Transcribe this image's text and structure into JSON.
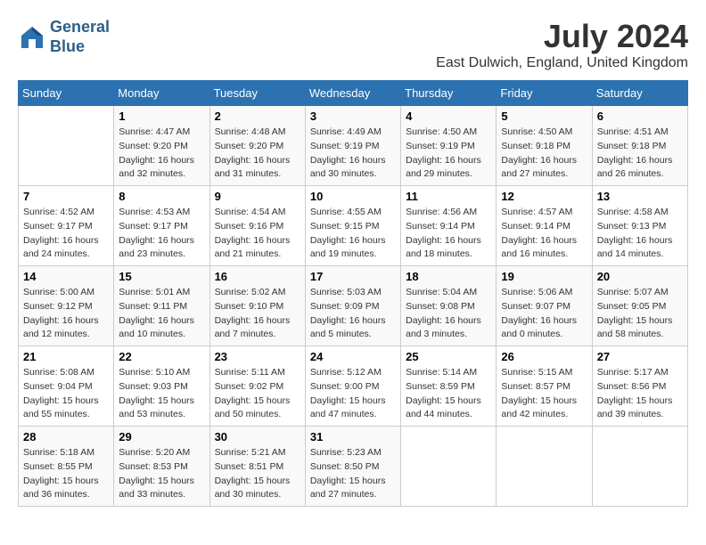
{
  "logo": {
    "line1": "General",
    "line2": "Blue"
  },
  "title": "July 2024",
  "location": "East Dulwich, England, United Kingdom",
  "days_of_week": [
    "Sunday",
    "Monday",
    "Tuesday",
    "Wednesday",
    "Thursday",
    "Friday",
    "Saturday"
  ],
  "weeks": [
    [
      {
        "day": "",
        "info": ""
      },
      {
        "day": "1",
        "info": "Sunrise: 4:47 AM\nSunset: 9:20 PM\nDaylight: 16 hours\nand 32 minutes."
      },
      {
        "day": "2",
        "info": "Sunrise: 4:48 AM\nSunset: 9:20 PM\nDaylight: 16 hours\nand 31 minutes."
      },
      {
        "day": "3",
        "info": "Sunrise: 4:49 AM\nSunset: 9:19 PM\nDaylight: 16 hours\nand 30 minutes."
      },
      {
        "day": "4",
        "info": "Sunrise: 4:50 AM\nSunset: 9:19 PM\nDaylight: 16 hours\nand 29 minutes."
      },
      {
        "day": "5",
        "info": "Sunrise: 4:50 AM\nSunset: 9:18 PM\nDaylight: 16 hours\nand 27 minutes."
      },
      {
        "day": "6",
        "info": "Sunrise: 4:51 AM\nSunset: 9:18 PM\nDaylight: 16 hours\nand 26 minutes."
      }
    ],
    [
      {
        "day": "7",
        "info": "Sunrise: 4:52 AM\nSunset: 9:17 PM\nDaylight: 16 hours\nand 24 minutes."
      },
      {
        "day": "8",
        "info": "Sunrise: 4:53 AM\nSunset: 9:17 PM\nDaylight: 16 hours\nand 23 minutes."
      },
      {
        "day": "9",
        "info": "Sunrise: 4:54 AM\nSunset: 9:16 PM\nDaylight: 16 hours\nand 21 minutes."
      },
      {
        "day": "10",
        "info": "Sunrise: 4:55 AM\nSunset: 9:15 PM\nDaylight: 16 hours\nand 19 minutes."
      },
      {
        "day": "11",
        "info": "Sunrise: 4:56 AM\nSunset: 9:14 PM\nDaylight: 16 hours\nand 18 minutes."
      },
      {
        "day": "12",
        "info": "Sunrise: 4:57 AM\nSunset: 9:14 PM\nDaylight: 16 hours\nand 16 minutes."
      },
      {
        "day": "13",
        "info": "Sunrise: 4:58 AM\nSunset: 9:13 PM\nDaylight: 16 hours\nand 14 minutes."
      }
    ],
    [
      {
        "day": "14",
        "info": "Sunrise: 5:00 AM\nSunset: 9:12 PM\nDaylight: 16 hours\nand 12 minutes."
      },
      {
        "day": "15",
        "info": "Sunrise: 5:01 AM\nSunset: 9:11 PM\nDaylight: 16 hours\nand 10 minutes."
      },
      {
        "day": "16",
        "info": "Sunrise: 5:02 AM\nSunset: 9:10 PM\nDaylight: 16 hours\nand 7 minutes."
      },
      {
        "day": "17",
        "info": "Sunrise: 5:03 AM\nSunset: 9:09 PM\nDaylight: 16 hours\nand 5 minutes."
      },
      {
        "day": "18",
        "info": "Sunrise: 5:04 AM\nSunset: 9:08 PM\nDaylight: 16 hours\nand 3 minutes."
      },
      {
        "day": "19",
        "info": "Sunrise: 5:06 AM\nSunset: 9:07 PM\nDaylight: 16 hours\nand 0 minutes."
      },
      {
        "day": "20",
        "info": "Sunrise: 5:07 AM\nSunset: 9:05 PM\nDaylight: 15 hours\nand 58 minutes."
      }
    ],
    [
      {
        "day": "21",
        "info": "Sunrise: 5:08 AM\nSunset: 9:04 PM\nDaylight: 15 hours\nand 55 minutes."
      },
      {
        "day": "22",
        "info": "Sunrise: 5:10 AM\nSunset: 9:03 PM\nDaylight: 15 hours\nand 53 minutes."
      },
      {
        "day": "23",
        "info": "Sunrise: 5:11 AM\nSunset: 9:02 PM\nDaylight: 15 hours\nand 50 minutes."
      },
      {
        "day": "24",
        "info": "Sunrise: 5:12 AM\nSunset: 9:00 PM\nDaylight: 15 hours\nand 47 minutes."
      },
      {
        "day": "25",
        "info": "Sunrise: 5:14 AM\nSunset: 8:59 PM\nDaylight: 15 hours\nand 44 minutes."
      },
      {
        "day": "26",
        "info": "Sunrise: 5:15 AM\nSunset: 8:57 PM\nDaylight: 15 hours\nand 42 minutes."
      },
      {
        "day": "27",
        "info": "Sunrise: 5:17 AM\nSunset: 8:56 PM\nDaylight: 15 hours\nand 39 minutes."
      }
    ],
    [
      {
        "day": "28",
        "info": "Sunrise: 5:18 AM\nSunset: 8:55 PM\nDaylight: 15 hours\nand 36 minutes."
      },
      {
        "day": "29",
        "info": "Sunrise: 5:20 AM\nSunset: 8:53 PM\nDaylight: 15 hours\nand 33 minutes."
      },
      {
        "day": "30",
        "info": "Sunrise: 5:21 AM\nSunset: 8:51 PM\nDaylight: 15 hours\nand 30 minutes."
      },
      {
        "day": "31",
        "info": "Sunrise: 5:23 AM\nSunset: 8:50 PM\nDaylight: 15 hours\nand 27 minutes."
      },
      {
        "day": "",
        "info": ""
      },
      {
        "day": "",
        "info": ""
      },
      {
        "day": "",
        "info": ""
      }
    ]
  ]
}
